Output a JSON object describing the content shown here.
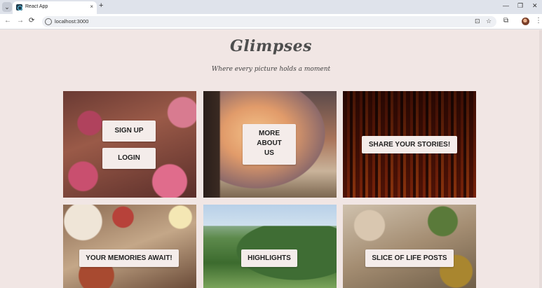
{
  "browser": {
    "tab_title": "React App",
    "tab_close": "×",
    "new_tab": "+",
    "url": "localhost:3000",
    "minimize": "—",
    "restore": "❐",
    "close": "✕"
  },
  "nav_icons": {
    "back": "←",
    "forward": "→",
    "reload": "⟳",
    "install": "⊡",
    "bookmark": "☆",
    "extensions": "⧉",
    "menu": "⋮"
  },
  "hero": {
    "title": "Glimpses",
    "tagline": "Where every picture holds a moment"
  },
  "cards": {
    "blossom": {
      "signup": "SIGN UP",
      "login": "LOGIN"
    },
    "about": {
      "label_line1": "MORE",
      "label_line2": "ABOUT",
      "label_line3": "US"
    },
    "stories": {
      "label": "SHARE YOUR STORIES!"
    },
    "memories": {
      "label": "YOUR MEMORIES AWAIT!"
    },
    "highlights": {
      "label": "HIGHLIGHTS"
    },
    "slice": {
      "label": "SLICE OF LIFE POSTS"
    }
  }
}
